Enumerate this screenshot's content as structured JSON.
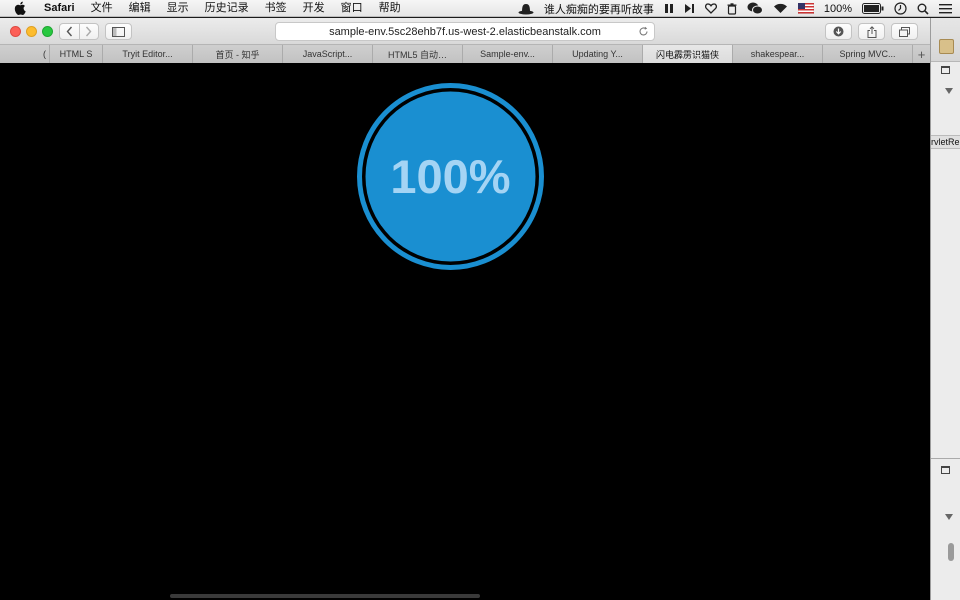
{
  "menubar": {
    "apple_icon": "apple-logo-icon",
    "app_name": "Safari",
    "items": [
      "文件",
      "编辑",
      "显示",
      "历史记录",
      "书签",
      "开发",
      "窗口",
      "帮助"
    ],
    "now_playing": "谁人痴痴的要再听故事",
    "battery_percent": "100%",
    "icons": [
      "hat-icon",
      "pause-icon",
      "next-track-icon",
      "heart-icon",
      "trash-icon",
      "wechat-icon",
      "wifi-icon",
      "us-flag-icon",
      "battery-icon",
      "clock-icon",
      "search-icon",
      "menu-icon"
    ]
  },
  "toolbar": {
    "address": "sample-env.5sc28ehb7f.us-west-2.elasticbeanstalk.com"
  },
  "tabs": [
    {
      "label": "(",
      "active": false
    },
    {
      "label": "HTML S",
      "active": false
    },
    {
      "label": "Tryit Editor...",
      "active": false
    },
    {
      "label": "首页 - 知乎",
      "active": false
    },
    {
      "label": "JavaScript...",
      "active": false
    },
    {
      "label": "HTML5 自动…",
      "active": false
    },
    {
      "label": "Sample-env...",
      "active": false
    },
    {
      "label": "Updating Y...",
      "active": false
    },
    {
      "label": "闪电霹雳识猫侠",
      "active": true
    },
    {
      "label": "shakespear...",
      "active": false
    },
    {
      "label": "Spring MVC...",
      "active": false
    }
  ],
  "new_tab_label": "+",
  "page": {
    "progress_label": "100%",
    "progress_value": 1.0,
    "ring_color": "#1a8fd1",
    "text_color": "#a4d4f4"
  },
  "background_window": {
    "partial_text": "rvletRe"
  }
}
